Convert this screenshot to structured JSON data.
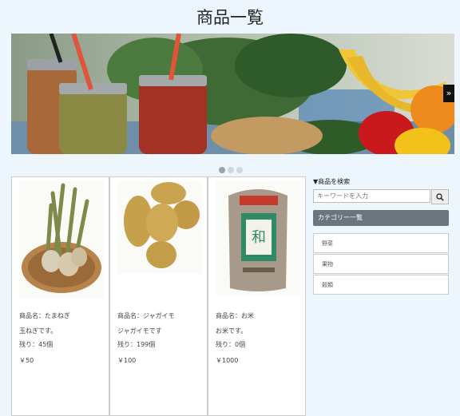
{
  "page": {
    "title": "商品一覧"
  },
  "carousel": {
    "next_label": "»",
    "slide_count": 3,
    "active_index": 0
  },
  "products": [
    {
      "name": "商品名：たまねぎ",
      "description": "玉ねぎです。",
      "stock": "残り：45個",
      "price": "￥50"
    },
    {
      "name": "商品名：ジャガイモ",
      "description": "ジャガイモです",
      "stock": "残り：199個",
      "price": "￥100"
    },
    {
      "name": "商品名：お米",
      "description": "お米です。",
      "stock": "残り：0個",
      "price": "￥1000"
    }
  ],
  "sidebar": {
    "search_label": "▼商品を検索",
    "search_placeholder": "キーワードを入力",
    "category_header": "カテゴリー一覧",
    "categories": [
      "野菜",
      "果物",
      "穀類"
    ]
  },
  "colors": {
    "background": "#eef6fd",
    "category_header_bg": "#6c757d"
  }
}
